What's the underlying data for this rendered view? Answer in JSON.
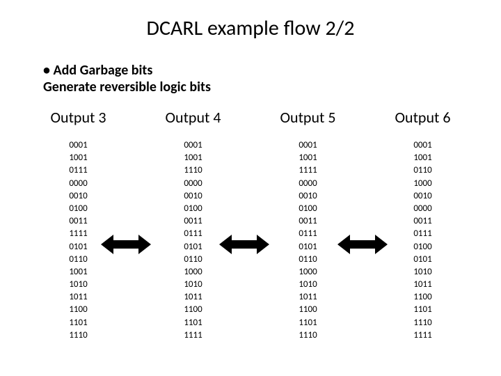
{
  "title": "DCARL example flow 2/2",
  "subhead_line1": "• Add Garbage bits",
  "subhead_line2": "Generate reversible logic bits",
  "columns": [
    {
      "head": "Output 3",
      "bits": "0001\n1001\n0111\n0000\n0010\n0100\n0011\n1111\n0101\n0110\n1001\n1010\n1011\n1100\n1101\n1110"
    },
    {
      "head": "Output 4",
      "bits": "0001\n1001\n1110\n0000\n0010\n0100\n0011\n0111\n0101\n0110\n1000\n1010\n1011\n1100\n1101\n1111"
    },
    {
      "head": "Output 5",
      "bits": "0001\n1001\n1111\n0000\n0010\n0100\n0011\n0111\n0101\n0110\n1000\n1010\n1011\n1100\n1101\n1110"
    },
    {
      "head": "Output 6",
      "bits": "0001\n1001\n0110\n1000\n0010\n0000\n0011\n0111\n0100\n0101\n1010\n1011\n1100\n1101\n1110\n1111"
    }
  ],
  "icons": {
    "double_arrow": "double-arrow-icon"
  }
}
